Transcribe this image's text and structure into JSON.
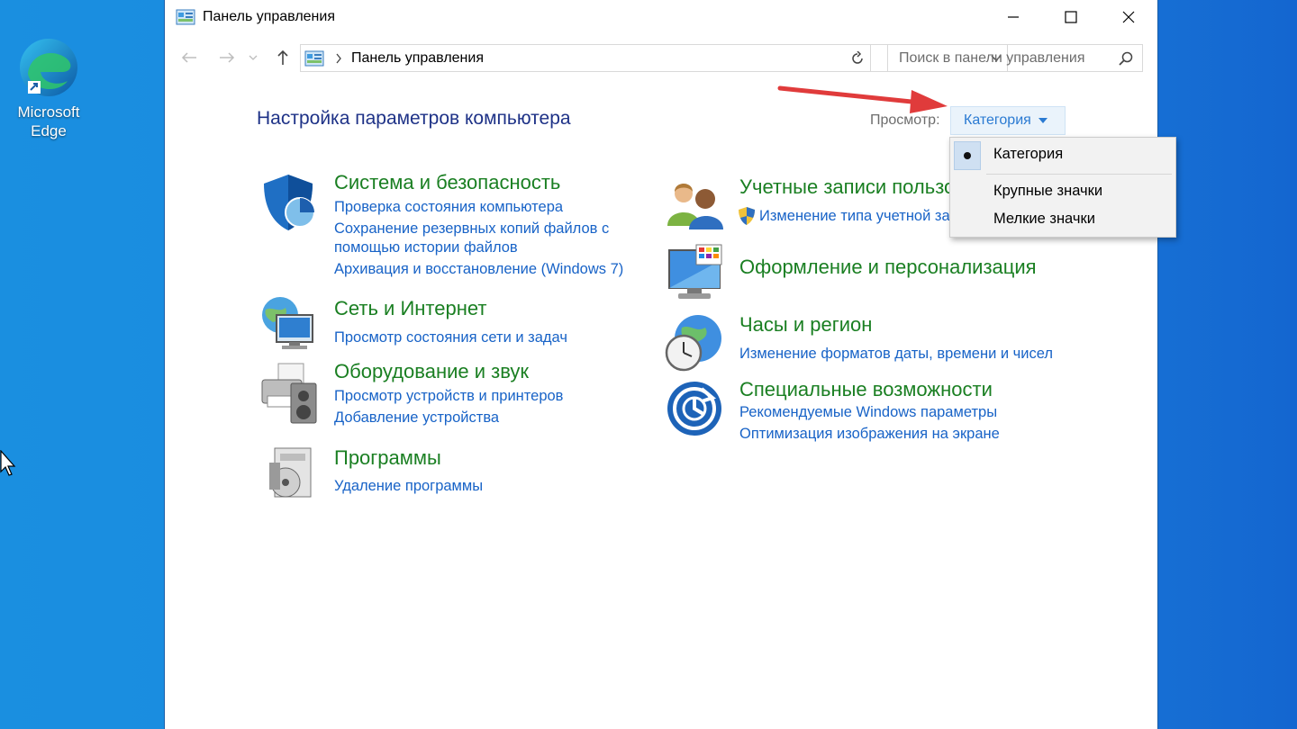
{
  "desktop": {
    "edge_label_1": "Microsoft",
    "edge_label_2": "Edge"
  },
  "window": {
    "title": "Панель управления",
    "breadcrumb": "Панель управления",
    "search_placeholder": "Поиск в панели управления"
  },
  "header": {
    "page_title": "Настройка параметров компьютера",
    "view_label": "Просмотр:",
    "view_selected": "Категория"
  },
  "view_menu": {
    "items": [
      "Категория",
      "Крупные значки",
      "Мелкие значки"
    ],
    "selected_index": 0
  },
  "categories": {
    "system": {
      "title": "Система и безопасность",
      "links": [
        "Проверка состояния компьютера",
        "Сохранение резервных копий файлов с",
        "помощью истории файлов",
        "Архивация и восстановление (Windows 7)"
      ]
    },
    "network": {
      "title": "Сеть и Интернет",
      "links": [
        "Просмотр состояния сети и задач"
      ]
    },
    "hardware": {
      "title": "Оборудование и звук",
      "links": [
        "Просмотр устройств и принтеров",
        "Добавление устройства"
      ]
    },
    "programs": {
      "title": "Программы",
      "links": [
        "Удаление программы"
      ]
    },
    "accounts": {
      "title": "Учетные записи пользо",
      "links": [
        "Изменение типа учетной за"
      ]
    },
    "appearance": {
      "title": "Оформление и персонализация",
      "links": []
    },
    "clock": {
      "title": "Часы и регион",
      "links": [
        "Изменение форматов даты, времени и чисел"
      ]
    },
    "access": {
      "title": "Специальные возможности",
      "links": [
        "Рекомендуемые Windows параметры",
        "Оптимизация изображения на экране"
      ]
    }
  },
  "colors": {
    "category_title": "#1a7f22",
    "link": "#1863c7",
    "heading": "#1e3287",
    "accent": "#2a7ad2",
    "annotation_arrow": "#e03b3b"
  }
}
